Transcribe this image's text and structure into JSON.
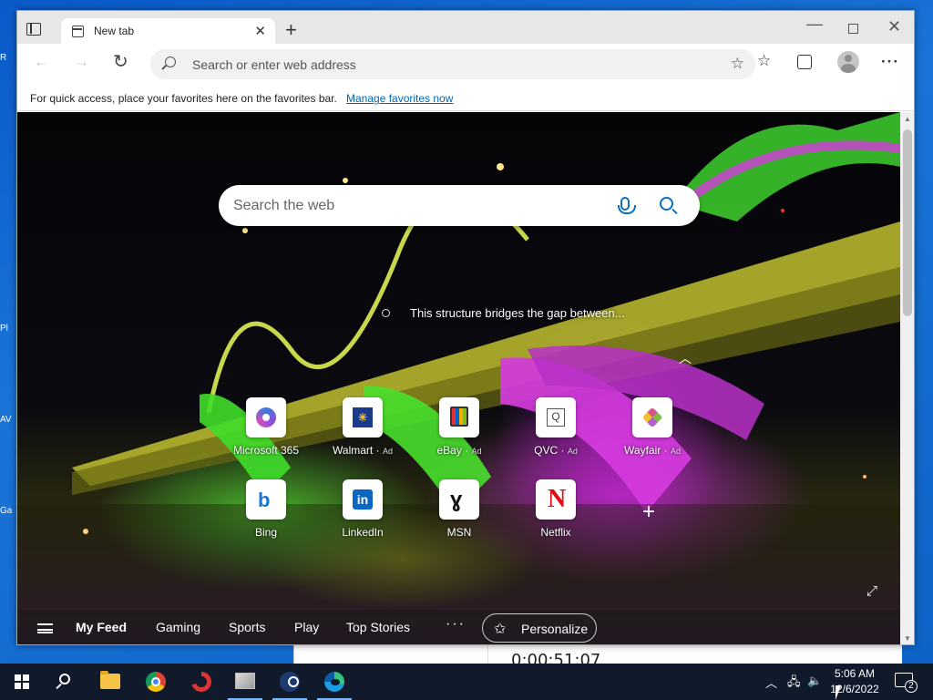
{
  "browser": {
    "tab_title": "New tab",
    "address_placeholder": "Search or enter web address",
    "favbar_text": "For quick access, place your favorites here on the favorites bar.",
    "favbar_link": "Manage favorites now"
  },
  "newtab": {
    "search_placeholder": "Search the web",
    "image_caption": "This structure bridges the gap between...",
    "shortcuts": [
      {
        "label": "Microsoft 365",
        "ad": "",
        "icon": "microsoft-365-icon"
      },
      {
        "label": "Walmart",
        "ad": "Ad",
        "icon": "walmart-icon",
        "icon_text": "Walmart"
      },
      {
        "label": "eBay",
        "ad": "Ad",
        "icon": "ebay-icon"
      },
      {
        "label": "QVC",
        "ad": "Ad",
        "icon": "qvc-icon",
        "icon_text": "Q"
      },
      {
        "label": "Wayfair",
        "ad": "Ad",
        "icon": "wayfair-icon"
      },
      {
        "label": "Bing",
        "ad": "",
        "icon": "bing-icon",
        "icon_text": "b"
      },
      {
        "label": "LinkedIn",
        "ad": "",
        "icon": "linkedin-icon",
        "icon_text": "in"
      },
      {
        "label": "MSN",
        "ad": "",
        "icon": "msn-icon",
        "icon_text": "ɣ"
      },
      {
        "label": "Netflix",
        "ad": "",
        "icon": "netflix-icon",
        "icon_text": "N"
      }
    ],
    "feed_tabs": [
      "My Feed",
      "Gaming",
      "Sports",
      "Play",
      "Top Stories"
    ],
    "more_label": "···",
    "personalize_label": "Personalize"
  },
  "background_window": {
    "timer": "0:00:51:07"
  },
  "taskbar": {
    "time": "5:06 AM",
    "date": "12/6/2022",
    "notification_count": "2"
  },
  "colors": {
    "accent": "#0f6cbd",
    "link": "#0066b4",
    "taskbar": "#101a2a"
  }
}
